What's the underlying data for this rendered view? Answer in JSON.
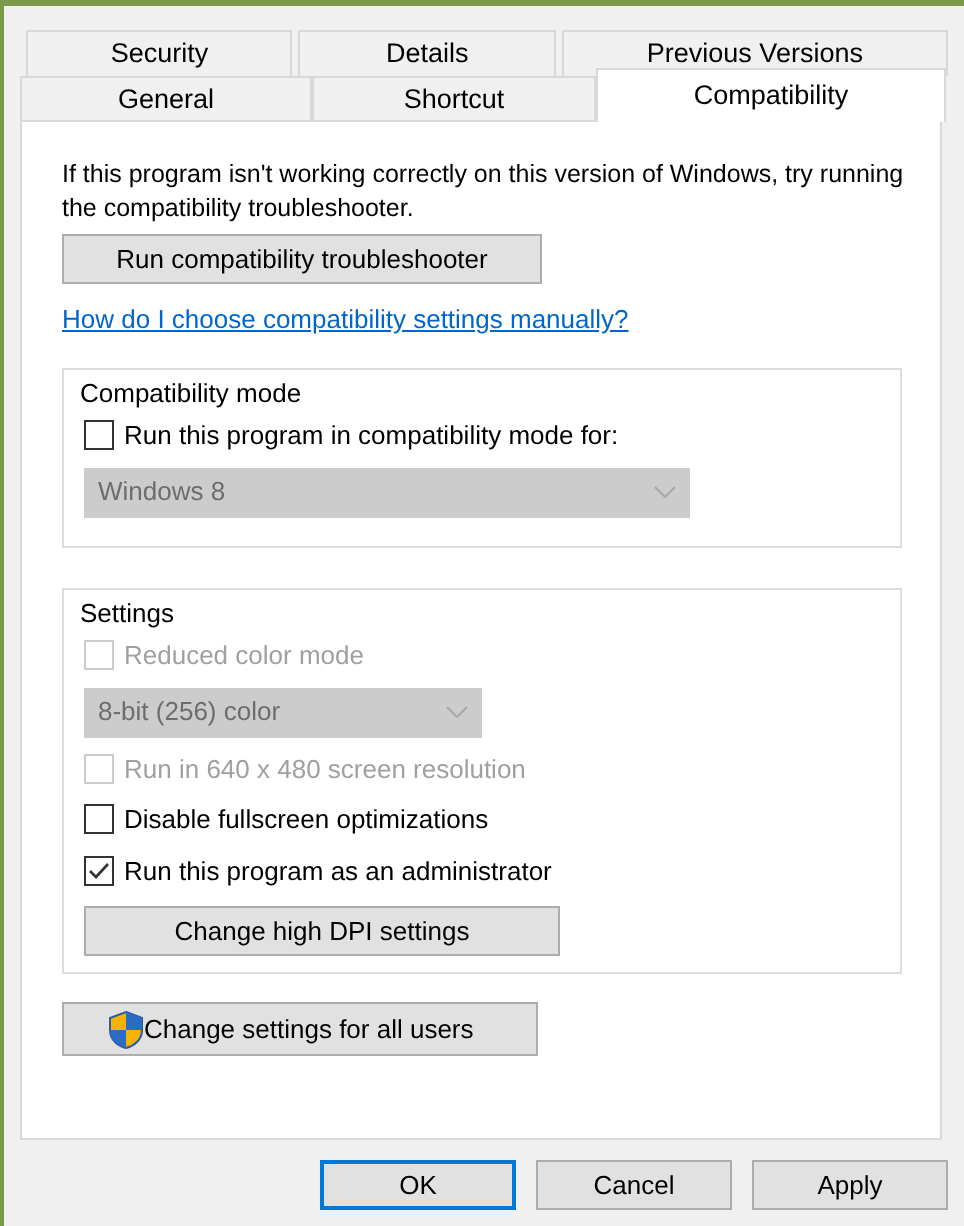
{
  "tab_rows": [
    [
      {
        "label": "Security",
        "selected": false
      },
      {
        "label": "Details",
        "selected": false
      },
      {
        "label": "Previous Versions",
        "selected": false
      }
    ],
    [
      {
        "label": "General",
        "selected": false
      },
      {
        "label": "Shortcut",
        "selected": false
      },
      {
        "label": "Compatibility",
        "selected": true
      }
    ]
  ],
  "intro": "If this program isn't working correctly on this version of Windows, try running the compatibility troubleshooter.",
  "troubleshooter_button": "Run compatibility troubleshooter",
  "help_link": "How do I choose compatibility settings manually?",
  "groups": [
    {
      "title": "Compatibility mode",
      "controls": [
        {
          "kind": "checkbox",
          "label": "Run this program in compatibility mode for:",
          "checked": false,
          "disabled": false
        },
        {
          "kind": "select",
          "value": "Windows 8",
          "disabled": true
        }
      ]
    },
    {
      "title": "Settings",
      "controls": [
        {
          "kind": "checkbox",
          "label": "Reduced color mode",
          "checked": false,
          "disabled": true
        },
        {
          "kind": "select",
          "value": "8-bit (256) color",
          "disabled": true
        },
        {
          "kind": "checkbox",
          "label": "Run in 640 x 480 screen resolution",
          "checked": false,
          "disabled": true
        },
        {
          "kind": "checkbox",
          "label": "Disable fullscreen optimizations",
          "checked": false,
          "disabled": false
        },
        {
          "kind": "checkbox",
          "label": "Run this program as an administrator",
          "checked": true,
          "disabled": false
        },
        {
          "kind": "button",
          "label": "Change high DPI settings"
        }
      ]
    }
  ],
  "all_users_button": "Change settings for all users",
  "dialog_buttons": [
    {
      "label": "OK",
      "default": true
    },
    {
      "label": "Cancel",
      "default": false
    },
    {
      "label": "Apply",
      "default": false
    }
  ]
}
